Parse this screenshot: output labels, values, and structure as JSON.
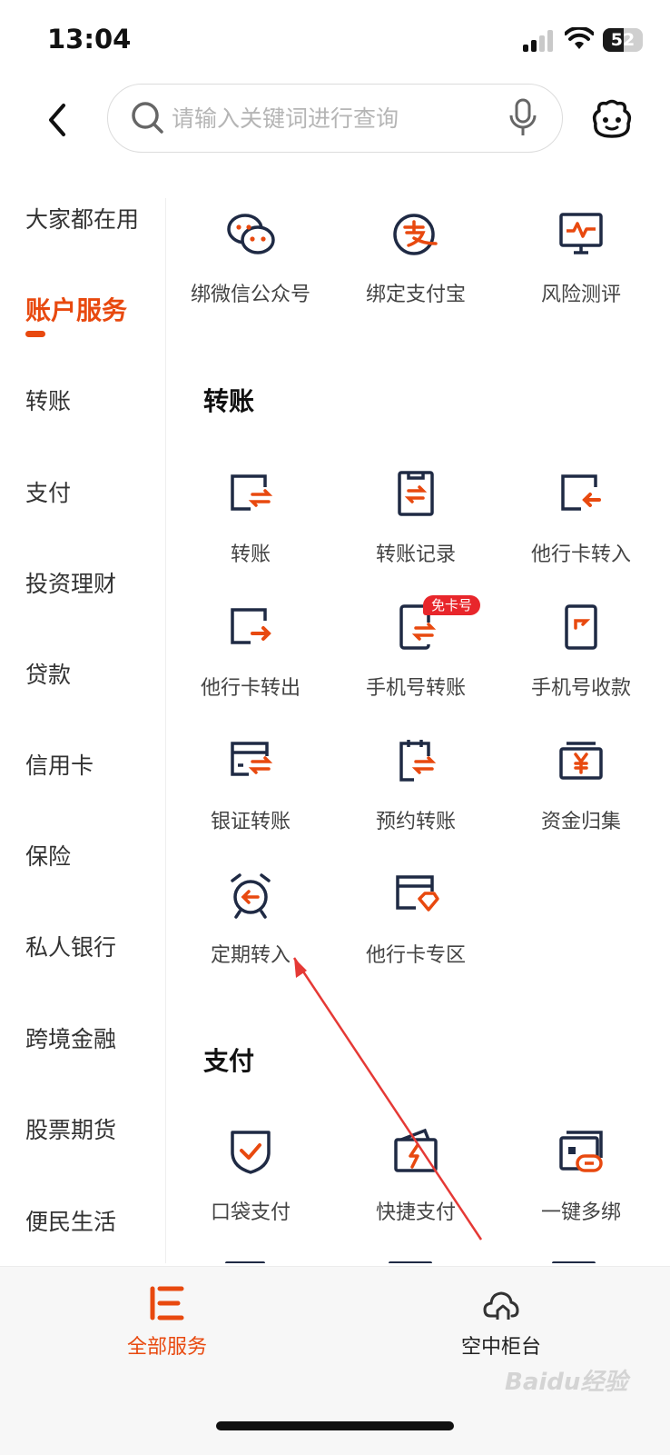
{
  "status_bar": {
    "time": "13:04",
    "battery": "52",
    "battery_fill": 0.52
  },
  "search": {
    "placeholder": "请输入关键词进行查询"
  },
  "sidebar": {
    "items": [
      {
        "label": "大家都在用"
      },
      {
        "label": "账户服务",
        "active": true
      },
      {
        "label": "转账"
      },
      {
        "label": "支付"
      },
      {
        "label": "投资理财"
      },
      {
        "label": "贷款"
      },
      {
        "label": "信用卡"
      },
      {
        "label": "保险"
      },
      {
        "label": "私人银行"
      },
      {
        "label": "跨境金融"
      },
      {
        "label": "股票期货"
      },
      {
        "label": "便民生活"
      }
    ]
  },
  "account_section": {
    "items": [
      {
        "label": "绑微信公众号",
        "icon": "wechat-icon"
      },
      {
        "label": "绑定支付宝",
        "icon": "alipay-icon"
      },
      {
        "label": "风险测评",
        "icon": "risk-monitor-icon"
      }
    ]
  },
  "transfer_section": {
    "title": "转账",
    "items": [
      {
        "label": "转账",
        "icon": "transfer-icon"
      },
      {
        "label": "转账记录",
        "icon": "transfer-record-icon"
      },
      {
        "label": "他行卡转入",
        "icon": "other-bank-in-icon"
      },
      {
        "label": "他行卡转出",
        "icon": "other-bank-out-icon"
      },
      {
        "label": "手机号转账",
        "icon": "phone-transfer-icon",
        "badge": "免卡号"
      },
      {
        "label": "手机号收款",
        "icon": "phone-receive-icon"
      },
      {
        "label": "银证转账",
        "icon": "bank-securities-icon"
      },
      {
        "label": "预约转账",
        "icon": "scheduled-transfer-icon"
      },
      {
        "label": "资金归集",
        "icon": "fund-collection-icon"
      },
      {
        "label": "定期转入",
        "icon": "alarm-clock-icon"
      },
      {
        "label": "他行卡专区",
        "icon": "other-bank-zone-icon"
      }
    ]
  },
  "payment_section": {
    "title": "支付",
    "items": [
      {
        "label": "口袋支付",
        "icon": "pocket-pay-icon"
      },
      {
        "label": "快捷支付",
        "icon": "quick-pay-icon"
      },
      {
        "label": "一键多绑",
        "icon": "multi-bind-icon"
      }
    ]
  },
  "bottom_nav": {
    "tabs": [
      {
        "label": "全部服务",
        "icon": "all-services-icon",
        "active": true
      },
      {
        "label": "空中柜台",
        "icon": "cloud-counter-icon"
      }
    ]
  },
  "watermark": "Baidu经验",
  "colors": {
    "accent": "#e8490f",
    "icon_dark": "#1f2a44",
    "badge": "#e8262b"
  }
}
